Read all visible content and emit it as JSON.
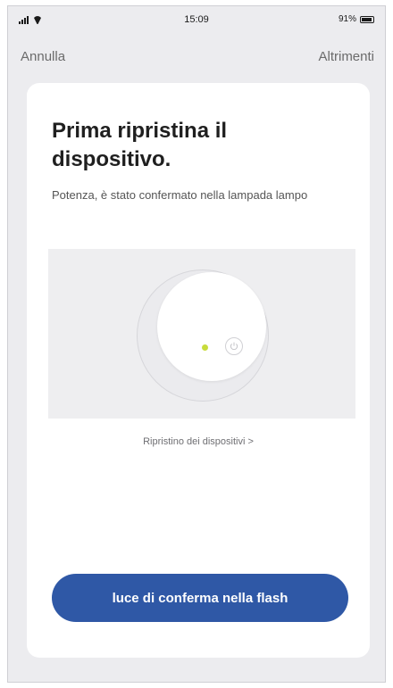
{
  "status_bar": {
    "time": "15:09",
    "battery": "91%",
    "battery_level": 0.91
  },
  "nav": {
    "cancel_label": "Annulla",
    "alternative_label": "Altrimenti"
  },
  "card": {
    "title": "Prima ripristina il dispositivo.",
    "subtitle": "Potenza, è stato confermato nella lampada lampo",
    "reset_link": "Ripristino dei dispositivi >",
    "confirm_button": "luce di conferma nella flash"
  },
  "colors": {
    "accent": "#2f58a6",
    "led": "#c8dc3c",
    "background": "#ececef"
  },
  "icons": {
    "signal": "signal-icon",
    "wifi": "wifi-icon",
    "battery": "battery-icon",
    "power": "power-icon"
  }
}
